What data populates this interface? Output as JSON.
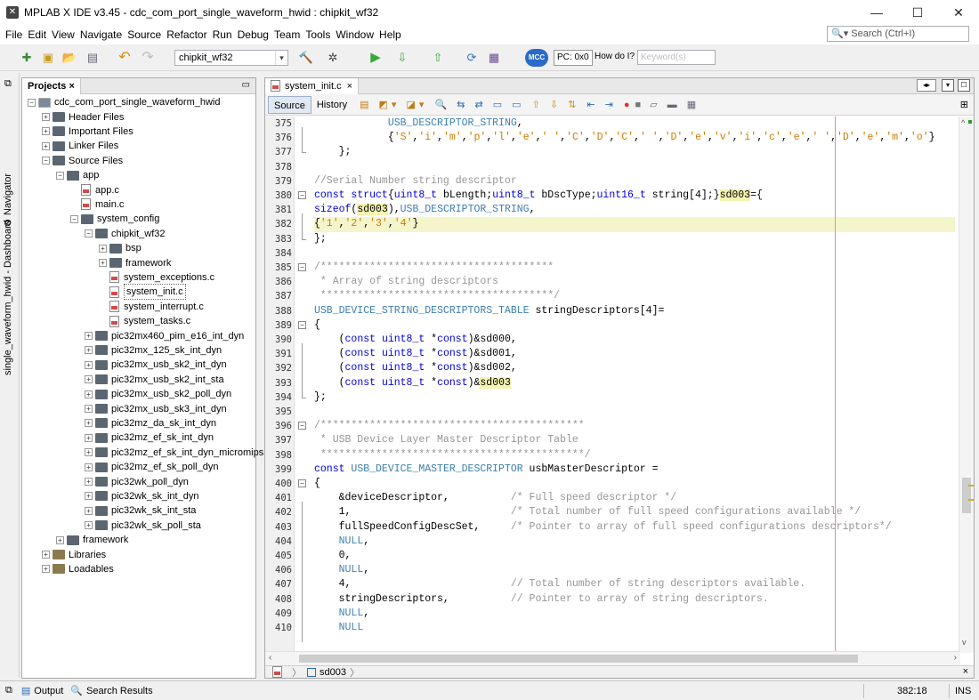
{
  "window": {
    "title": "MPLAB X IDE v3.45 - cdc_com_port_single_waveform_hwid : chipkit_wf32"
  },
  "menu": [
    "File",
    "Edit",
    "View",
    "Navigate",
    "Source",
    "Refactor",
    "Run",
    "Debug",
    "Team",
    "Tools",
    "Window",
    "Help"
  ],
  "search": {
    "placeholder": "Search (Ctrl+I)"
  },
  "toolbar": {
    "config_select": "chipkit_wf32",
    "pc_label": "PC: 0x0",
    "howdoi_label": "How do I?",
    "keyword_placeholder": "Keyword(s)",
    "mcc_label": "MCC"
  },
  "side_tabs": {
    "navigator": "Navigator",
    "dashboard": "single_waveform_hwid - Dashboard"
  },
  "projects": {
    "tab_label": "Projects",
    "tree": [
      {
        "label": "cdc_com_port_single_waveform_hwid",
        "kind": "project",
        "expander": "−"
      },
      {
        "label": "Header Files",
        "kind": "folder",
        "expander": "+"
      },
      {
        "label": "Important Files",
        "kind": "folder",
        "expander": "+"
      },
      {
        "label": "Linker Files",
        "kind": "folder",
        "expander": "+"
      },
      {
        "label": "Source Files",
        "kind": "folder",
        "expander": "−"
      },
      {
        "label": "app",
        "kind": "folder",
        "expander": "−"
      },
      {
        "label": "app.c",
        "kind": "file",
        "expander": ""
      },
      {
        "label": "main.c",
        "kind": "file",
        "expander": ""
      },
      {
        "label": "system_config",
        "kind": "folder",
        "expander": "−"
      },
      {
        "label": "chipkit_wf32",
        "kind": "folder",
        "expander": "−"
      },
      {
        "label": "bsp",
        "kind": "folder",
        "expander": "+"
      },
      {
        "label": "framework",
        "kind": "folder",
        "expander": "+"
      },
      {
        "label": "system_exceptions.c",
        "kind": "file",
        "expander": ""
      },
      {
        "label": "system_init.c",
        "kind": "file",
        "expander": ""
      },
      {
        "label": "system_interrupt.c",
        "kind": "file",
        "expander": ""
      },
      {
        "label": "system_tasks.c",
        "kind": "file",
        "expander": ""
      },
      {
        "label": "pic32mx460_pim_e16_int_dyn",
        "kind": "folder",
        "expander": "+"
      },
      {
        "label": "pic32mx_125_sk_int_dyn",
        "kind": "folder",
        "expander": "+"
      },
      {
        "label": "pic32mx_usb_sk2_int_dyn",
        "kind": "folder",
        "expander": "+"
      },
      {
        "label": "pic32mx_usb_sk2_int_sta",
        "kind": "folder",
        "expander": "+"
      },
      {
        "label": "pic32mx_usb_sk2_poll_dyn",
        "kind": "folder",
        "expander": "+"
      },
      {
        "label": "pic32mx_usb_sk3_int_dyn",
        "kind": "folder",
        "expander": "+"
      },
      {
        "label": "pic32mz_da_sk_int_dyn",
        "kind": "folder",
        "expander": "+"
      },
      {
        "label": "pic32mz_ef_sk_int_dyn",
        "kind": "folder",
        "expander": "+"
      },
      {
        "label": "pic32mz_ef_sk_int_dyn_micromips",
        "kind": "folder",
        "expander": "+"
      },
      {
        "label": "pic32mz_ef_sk_poll_dyn",
        "kind": "folder",
        "expander": "+"
      },
      {
        "label": "pic32wk_poll_dyn",
        "kind": "folder",
        "expander": "+"
      },
      {
        "label": "pic32wk_sk_int_dyn",
        "kind": "folder",
        "expander": "+"
      },
      {
        "label": "pic32wk_sk_int_sta",
        "kind": "folder",
        "expander": "+"
      },
      {
        "label": "pic32wk_sk_poll_sta",
        "kind": "folder",
        "expander": "+"
      },
      {
        "label": "framework",
        "kind": "folder",
        "expander": "+"
      },
      {
        "label": "Libraries",
        "kind": "lib",
        "expander": "+"
      },
      {
        "label": "Loadables",
        "kind": "lib",
        "expander": "+"
      }
    ]
  },
  "editor": {
    "tab_label": "system_init.c",
    "source_label": "Source",
    "history_label": "History",
    "breadcrumb": "sd003",
    "lines": [
      {
        "n": "375",
        "text": "            USB_DESCRIPTOR_STRING,"
      },
      {
        "n": "376",
        "text": "            {'S','i','m','p','l','e',' ','C','D','C',' ','D','e','v','i','c','e',' ','D','e','m','o'}"
      },
      {
        "n": "377",
        "text": "    };"
      },
      {
        "n": "378",
        "text": ""
      },
      {
        "n": "379",
        "text": "//Serial Number string descriptor"
      },
      {
        "n": "380",
        "text": "const struct{uint8_t bLength;uint8_t bDscType;uint16_t string[4];}sd003={"
      },
      {
        "n": "381",
        "text": "sizeof(sd003),USB_DESCRIPTOR_STRING,"
      },
      {
        "n": "382",
        "text": "{'1','2','3','4'}"
      },
      {
        "n": "383",
        "text": "};"
      },
      {
        "n": "384",
        "text": ""
      },
      {
        "n": "385",
        "text": "/**************************************"
      },
      {
        "n": "386",
        "text": " * Array of string descriptors"
      },
      {
        "n": "387",
        "text": " **************************************/"
      },
      {
        "n": "388",
        "text": "USB_DEVICE_STRING_DESCRIPTORS_TABLE stringDescriptors[4]="
      },
      {
        "n": "389",
        "text": "{"
      },
      {
        "n": "390",
        "text": "    (const uint8_t *const)&sd000,"
      },
      {
        "n": "391",
        "text": "    (const uint8_t *const)&sd001,"
      },
      {
        "n": "392",
        "text": "    (const uint8_t *const)&sd002,"
      },
      {
        "n": "393",
        "text": "    (const uint8_t *const)&sd003"
      },
      {
        "n": "394",
        "text": "};"
      },
      {
        "n": "395",
        "text": ""
      },
      {
        "n": "396",
        "text": "/*******************************************"
      },
      {
        "n": "397",
        "text": " * USB Device Layer Master Descriptor Table"
      },
      {
        "n": "398",
        "text": " *******************************************/"
      },
      {
        "n": "399",
        "text": "const USB_DEVICE_MASTER_DESCRIPTOR usbMasterDescriptor ="
      },
      {
        "n": "400",
        "text": "{"
      },
      {
        "n": "401",
        "text": "    &deviceDescriptor,          /* Full speed descriptor */"
      },
      {
        "n": "402",
        "text": "    1,                          /* Total number of full speed configurations available */"
      },
      {
        "n": "403",
        "text": "    fullSpeedConfigDescSet,     /* Pointer to array of full speed configurations descriptors*/"
      },
      {
        "n": "404",
        "text": "    NULL,"
      },
      {
        "n": "405",
        "text": "    0,"
      },
      {
        "n": "406",
        "text": "    NULL,"
      },
      {
        "n": "407",
        "text": "    4,                          // Total number of string descriptors available."
      },
      {
        "n": "408",
        "text": "    stringDescriptors,          // Pointer to array of string descriptors."
      },
      {
        "n": "409",
        "text": "    NULL,"
      },
      {
        "n": "410",
        "text": "    NULL"
      }
    ]
  },
  "status": {
    "output_label": "Output",
    "search_results_label": "Search Results",
    "position": "382:18",
    "mode": "INS"
  }
}
